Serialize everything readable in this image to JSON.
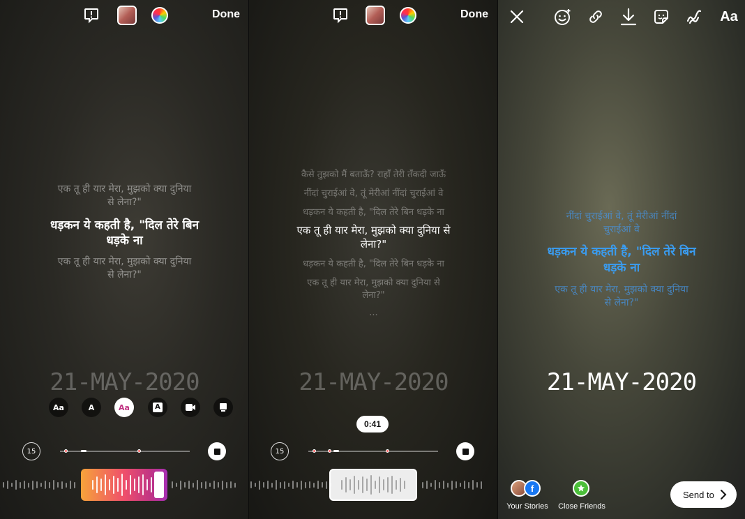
{
  "panel1": {
    "done_label": "Done",
    "lyrics": [
      "एक तू ही यार मेरा, मुझको क्या दुनिया",
      "से लेना?\"",
      "धड़कन ये कहती है, \"दिल तेरे बिन",
      "धड़के ना",
      "एक तू ही यार मेरा, मुझको क्या दुनिया",
      "से लेना?\""
    ],
    "date": "21-MAY-2020",
    "style_buttons": [
      "Aa",
      "A",
      "Aa",
      "A",
      "",
      ""
    ],
    "skip_label": "15"
  },
  "panel2": {
    "done_label": "Done",
    "lyrics": [
      "कैसे तुझको मैं बताऊँ? राहाँ तेरी तँकदी जाऊँ",
      "नींदां चुराईआं वे, तूं मेरीआं नींदां चुराईआं वे",
      "धड़कन ये कहती है, \"दिल तेरे बिन धड़के ना",
      "एक तू ही यार मेरा, मुझको क्या दुनिया से",
      "लेना?\"",
      "धड़कन ये कहती है, \"दिल तेरे बिन धड़के ना",
      "एक तू ही यार मेरा, मुझको क्या दुनिया से",
      "लेना?\"",
      "..."
    ],
    "date": "21-MAY-2020",
    "time_bubble": "0:41",
    "skip_label": "15"
  },
  "panel3": {
    "lyrics": [
      "नींदां चुराईआं वे, तूं मेरीआं नींदां",
      "चुराईआं वे",
      "धड़कन ये कहती है, \"दिल तेरे बिन",
      "धड़के ना",
      "एक तू ही यार मेरा, मुझको क्या दुनिया",
      "से लेना?\""
    ],
    "date": "21-MAY-2020",
    "top_text_button": "Aa",
    "your_stories_label": "Your Stories",
    "close_friends_label": "Close Friends",
    "send_to_label": "Send to"
  },
  "colors": {
    "lyric_blue": "#3a9cf0",
    "instagram_gradient_start": "#f6a33a",
    "instagram_gradient_end": "#a62fb5",
    "close_friends_green": "#4cbf3a"
  }
}
